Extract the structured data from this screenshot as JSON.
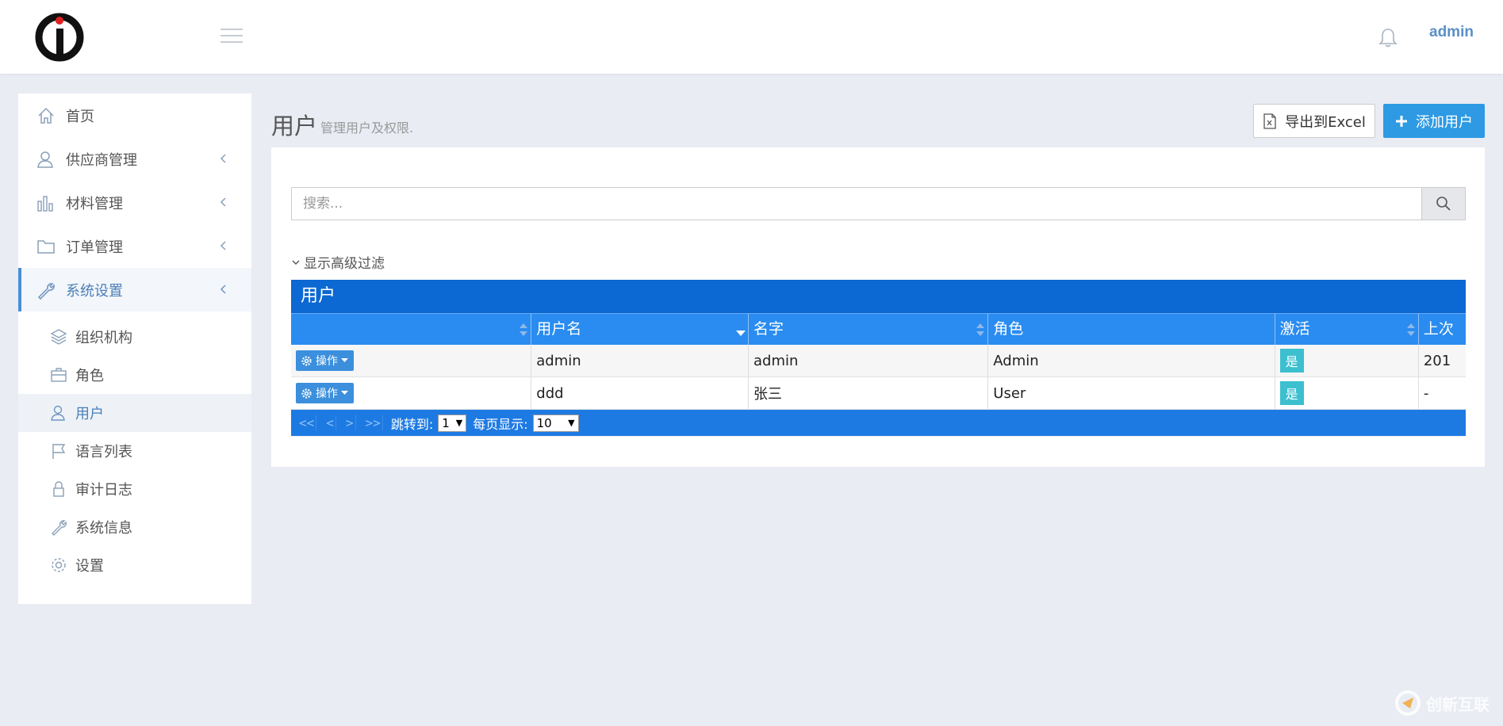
{
  "header": {
    "user": "admin"
  },
  "sidebar": {
    "items": [
      {
        "label": "首页",
        "icon": "home-icon"
      },
      {
        "label": "供应商管理",
        "icon": "supplier-icon"
      },
      {
        "label": "材料管理",
        "icon": "bar-chart-icon"
      },
      {
        "label": "订单管理",
        "icon": "folder-icon"
      },
      {
        "label": "系统设置",
        "icon": "wrench-icon"
      }
    ],
    "sub_items": [
      {
        "label": "组织机构",
        "icon": "layers-icon"
      },
      {
        "label": "角色",
        "icon": "briefcase-icon"
      },
      {
        "label": "用户",
        "icon": "user-icon"
      },
      {
        "label": "语言列表",
        "icon": "flag-icon"
      },
      {
        "label": "审计日志",
        "icon": "lock-icon"
      },
      {
        "label": "系统信息",
        "icon": "wrench-icon"
      },
      {
        "label": "设置",
        "icon": "gear-icon"
      }
    ]
  },
  "page": {
    "title": "用户",
    "subtitle": "管理用户及权限.",
    "export_label": "导出到Excel",
    "add_label": "添加用户"
  },
  "search": {
    "placeholder": "搜索...",
    "advanced_label": "显示高级过滤"
  },
  "grid": {
    "caption": "用户",
    "headers": [
      "",
      "用户名",
      "名字",
      "角色",
      "激活",
      "上次"
    ],
    "action_label": "操作",
    "rows": [
      {
        "username": "admin",
        "name": "admin",
        "role": "Admin",
        "active": "是",
        "last": "201"
      },
      {
        "username": "ddd",
        "name": "张三",
        "role": "User",
        "active": "是",
        "last": "-"
      }
    ]
  },
  "pager": {
    "first": "<<",
    "prev": "<",
    "next": ">",
    "last": ">>",
    "jump_label": "跳转到:",
    "page_value": "1",
    "size_label": "每页显示:",
    "size_value": "10"
  },
  "watermark": "创新互联",
  "colors": {
    "primary": "#2d9ae3",
    "grid_caption": "#0c68d2",
    "grid_header": "#2a8cf0",
    "badge": "#3cbfcf",
    "active_nav": "#4a8fd4"
  }
}
